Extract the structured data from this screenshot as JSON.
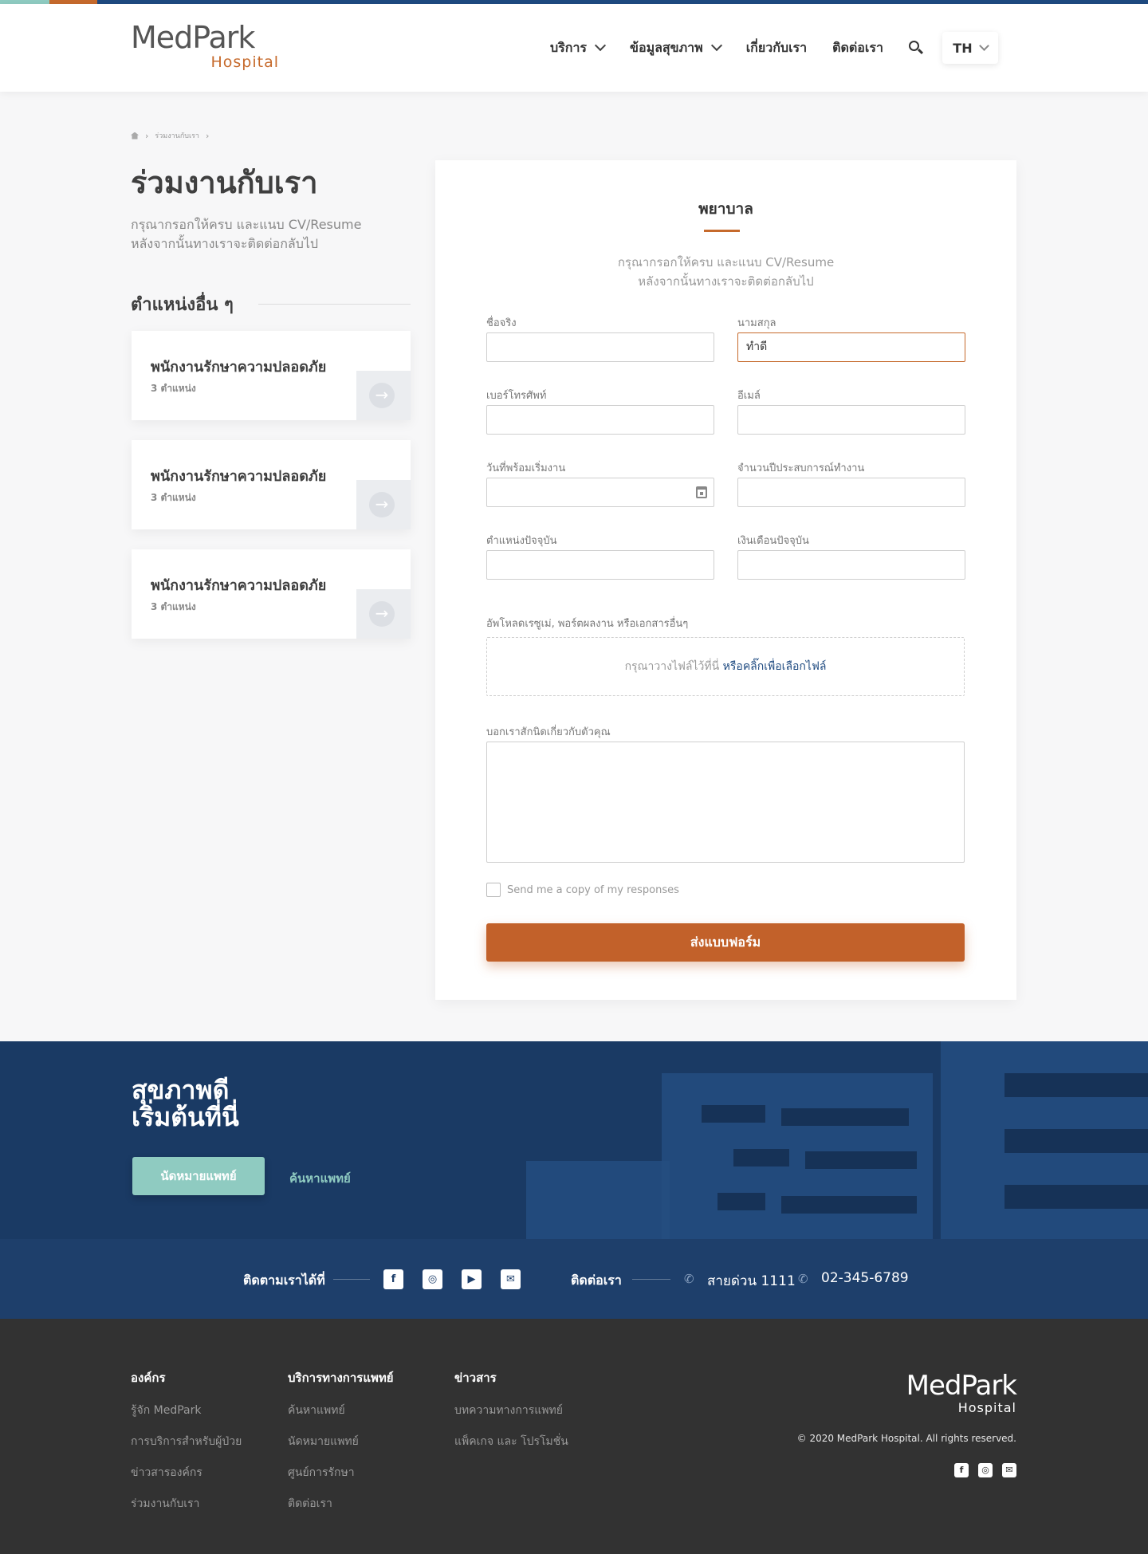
{
  "brand": {
    "name": "MedPark",
    "sub": "Hospital"
  },
  "nav": {
    "items": [
      "บริการ",
      "ข้อมูลสุขภาพ",
      "เกี่ยวกับเรา",
      "ติดต่อเรา"
    ],
    "lang": "TH"
  },
  "breadcrumb": {
    "current": "ร่วมงานกับเรา"
  },
  "page": {
    "title": "ร่วมงานกับเรา",
    "lead": "กรุณากรอกให้ครบ และแนบ CV/Resume หลังจากนั้นทางเราจะติดต่อกลับไป"
  },
  "other_positions": {
    "heading": "ตำแหน่งอื่น ๆ",
    "cards": [
      {
        "title": "พนักงานรักษาความปลอดภัย",
        "count": "3 ตำแหน่ง"
      },
      {
        "title": "พนักงานรักษาความปลอดภัย",
        "count": "3 ตำแหน่ง"
      },
      {
        "title": "พนักงานรักษาความปลอดภัย",
        "count": "3 ตำแหน่ง"
      }
    ]
  },
  "form": {
    "title": "พยาบาล",
    "desc": "กรุณากรอกให้ครบ และแนบ CV/Resume หลังจากนั้นทางเราจะติดต่อกลับไป",
    "fields": {
      "first_name": {
        "label": "ชื่อจริง",
        "value": ""
      },
      "last_name": {
        "label": "นามสกุล",
        "value": "ทำดี"
      },
      "phone": {
        "label": "เบอร์โทรศัพท์",
        "value": ""
      },
      "email": {
        "label": "อีเมล์",
        "value": ""
      },
      "start_date": {
        "label": "วันที่พร้อมเริ่มงาน",
        "value": ""
      },
      "experience": {
        "label": "จำนวนปีประสบการณ์ทำงาน",
        "value": ""
      },
      "current_position": {
        "label": "ตำแหน่งปัจจุบัน",
        "value": ""
      },
      "current_salary": {
        "label": "เงินเดือนปัจจุบัน",
        "value": ""
      }
    },
    "upload": {
      "label": "อัพโหลดเรซูเม่, พอร์ตผลงาน หรือเอกสารอื่นๆ",
      "hint": "กรุณาวางไฟล์ไว้ที่นี่ ",
      "link": "หรือคลิ๊กเพื่อเลือกไฟล์"
    },
    "about_label": "บอกเราสักนิดเกี่ยวกับตัวคุณ",
    "copy_label": "Send me a copy of my responses",
    "submit": "ส่งแบบฟอร์ม"
  },
  "cta": {
    "line1": "สุขภาพดี",
    "line2": "เริ่มต้นที่นี่",
    "appointment": "นัดหมายแพทย์",
    "find_doctor": "ค้นหาแพทย์"
  },
  "social": {
    "follow": "ติดตามเราได้ที่",
    "contact": "ติดต่อเรา",
    "hotline": "สายด่วน 1111",
    "phone": "02-345-6789"
  },
  "footer": {
    "cols": [
      {
        "heading": "องค์กร",
        "items": [
          "รู้จัก MedPark",
          "การบริการสำหรับผู้ป่วย",
          "ข่าวสารองค์กร",
          "ร่วมงานกับเรา"
        ]
      },
      {
        "heading": "บริการทางการแพทย์",
        "items": [
          "ค้นหาแพทย์",
          "นัดหมายแพทย์",
          "ศูนย์การรักษา",
          "ติดต่อเรา"
        ]
      },
      {
        "heading": "ข่าวสาร",
        "items": [
          "บทความทางการแพทย์",
          "แพ็คเกจ และ โปรโมชั่น"
        ]
      }
    ],
    "copyright": "© 2020 MedPark Hospital. All rights reserved."
  },
  "colors": {
    "brand_orange": "#c66a2c",
    "brand_navy": "#1e3f6b",
    "brand_teal": "#8fcbc1"
  }
}
